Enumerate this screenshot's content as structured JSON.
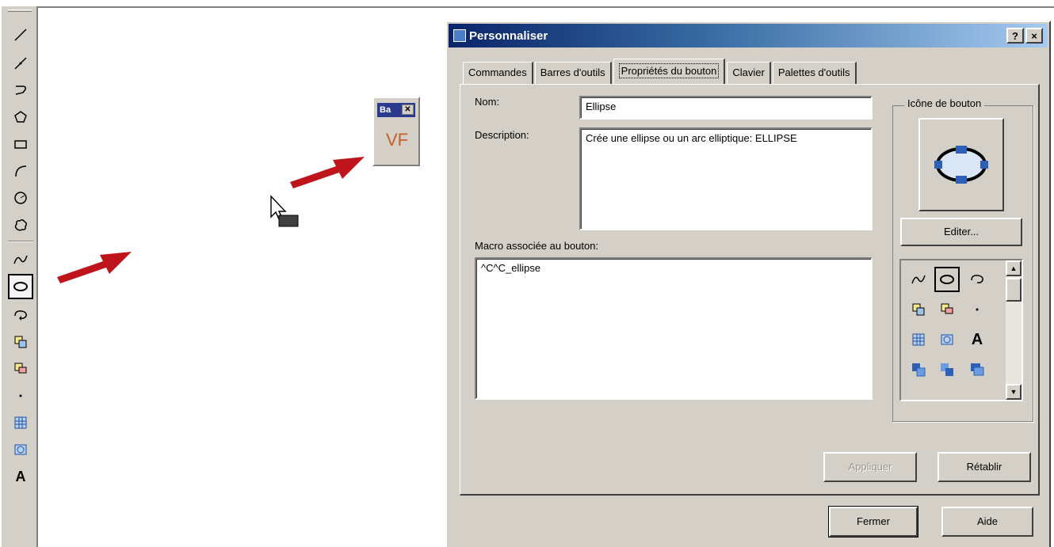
{
  "mini_toolbar": {
    "title": "Ba",
    "button_text": "VF"
  },
  "dialog": {
    "title": "Personnaliser",
    "help_btn": "?",
    "close_btn": "×",
    "tabs": [
      "Commandes",
      "Barres d'outils",
      "Propriétés du bouton",
      "Clavier",
      "Palettes d'outils"
    ],
    "active_tab": "Propriétés du bouton",
    "name_label": "Nom:",
    "name_value": "Ellipse",
    "description_label": "Description:",
    "description_value": "Crée une ellipse ou un arc elliptique: ELLIPSE",
    "macro_label": "Macro associée au bouton:",
    "macro_value": "^C^C_ellipse",
    "icon_group_title": "Icône de bouton",
    "edit_button": "Editer...",
    "apply_button": "Appliquer",
    "reset_button": "Rétablir",
    "close_button": "Fermer",
    "help_button": "Aide",
    "palette_text_icon": "A"
  },
  "toolbar_icons": [
    "line-icon",
    "construction-line-icon",
    "polyline-icon",
    "polygon-icon",
    "rectangle-icon",
    "arc-icon",
    "circle-icon",
    "revision-cloud-icon",
    "spline-icon",
    "ellipse-icon",
    "ellipse-arc-icon",
    "insert-block-icon",
    "make-block-icon",
    "point-icon",
    "hatch-icon",
    "region-icon",
    "multiline-text-icon"
  ],
  "toolbar_text_icon": "A",
  "colors": {
    "title_gradient_start": "#0a246a",
    "title_gradient_end": "#a6caf0",
    "arrow": "#c0141c",
    "face": "#d4d0c8"
  }
}
